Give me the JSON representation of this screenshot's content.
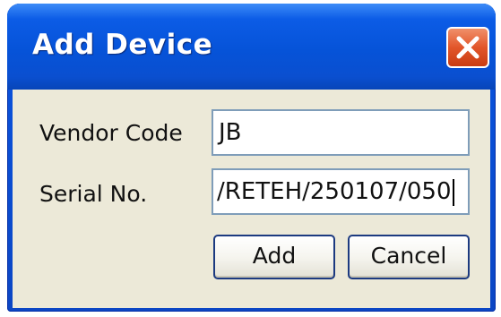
{
  "window": {
    "title": "Add Device",
    "close_icon": "close-icon"
  },
  "form": {
    "vendor_code": {
      "label": "Vendor Code",
      "value": "JB"
    },
    "serial_no": {
      "label": "Serial No.",
      "value": "/RETEH/250107/050"
    }
  },
  "buttons": {
    "add_label": "Add",
    "cancel_label": "Cancel"
  },
  "colors": {
    "titlebar": "#0653d8",
    "close_button": "#e2562a",
    "dialog_background": "#ece9d8"
  }
}
